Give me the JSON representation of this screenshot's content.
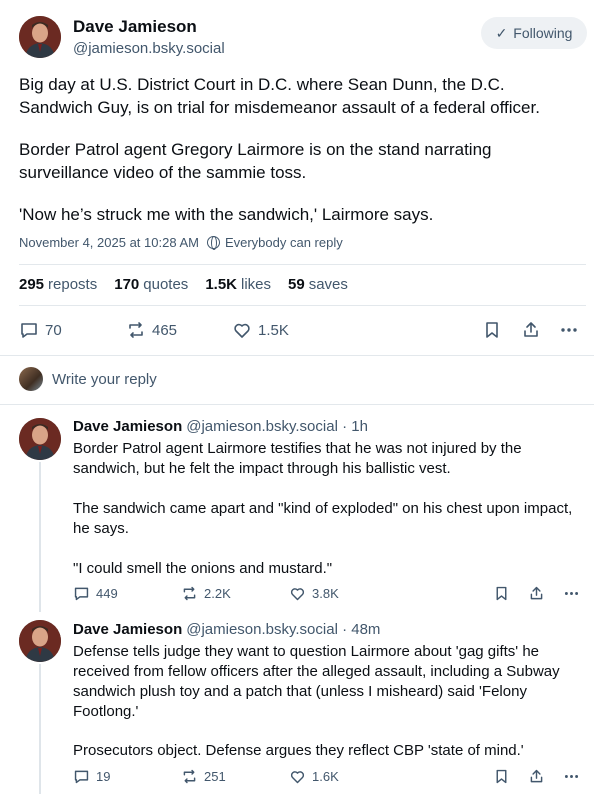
{
  "main_post": {
    "author_name": "Dave Jamieson",
    "author_handle": "@jamieson.bsky.social",
    "follow_label": "Following",
    "paragraphs": [
      "Big day at U.S. District Court in D.C. where Sean Dunn, the D.C. Sandwich Guy, is on trial for misdemeanor assault of a federal officer.",
      "Border Patrol agent Gregory Lairmore is on the stand narrating surveillance video of the sammie toss.",
      "'Now he’s struck me with the sandwich,' Lairmore says."
    ],
    "timestamp": "November 4, 2025 at 10:28 AM",
    "reply_setting": "Everybody can reply",
    "stats": [
      {
        "num": "295",
        "label": "reposts"
      },
      {
        "num": "170",
        "label": "quotes"
      },
      {
        "num": "1.5K",
        "label": "likes"
      },
      {
        "num": "59",
        "label": "saves"
      }
    ],
    "actions": {
      "replies": "70",
      "reposts": "465",
      "likes": "1.5K"
    }
  },
  "reply_composer": {
    "placeholder": "Write your reply"
  },
  "replies": [
    {
      "author_name": "Dave Jamieson",
      "author_handle": "@jamieson.bsky.social",
      "time": "· 1h",
      "paragraphs": [
        "Border Patrol agent Lairmore testifies that he was not injured by the sandwich, but he felt the impact through his ballistic vest.",
        "The sandwich came apart and \"kind of exploded\" on his chest upon impact, he says.",
        "\"I could smell the onions and mustard.\""
      ],
      "actions": {
        "replies": "449",
        "reposts": "2.2K",
        "likes": "3.8K"
      }
    },
    {
      "author_name": "Dave Jamieson",
      "author_handle": "@jamieson.bsky.social",
      "time": "· 48m",
      "paragraphs": [
        "Defense tells judge they want to question Lairmore about 'gag gifts' he received from fellow officers after the alleged assault, including a Subway sandwich plush toy and a patch that (unless I misheard) said 'Felony Footlong.'",
        "Prosecutors object. Defense argues they reflect CBP 'state of mind.'"
      ],
      "actions": {
        "replies": "19",
        "reposts": "251",
        "likes": "1.6K"
      }
    }
  ],
  "colors": {
    "text": "#0b0f14",
    "muted": "#42576c",
    "divider": "#e3e8ec",
    "follow_bg": "#eef1f4"
  }
}
